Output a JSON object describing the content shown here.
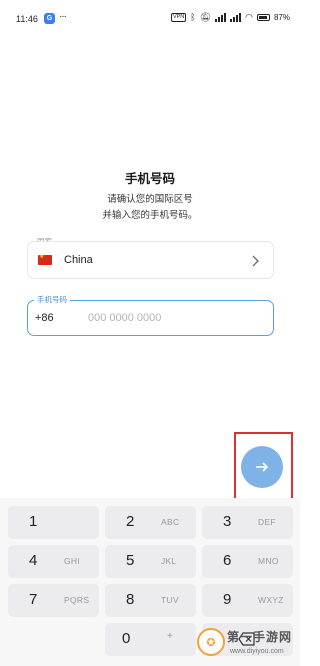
{
  "status_bar": {
    "time": "11:46",
    "app_icon_letter": "G",
    "overflow": "···",
    "vpn": "VPN",
    "battery_pct": "87%"
  },
  "heading": {
    "title": "手机号码",
    "line1": "请确认您的国际区号",
    "line2": "并输入您的手机号码。"
  },
  "country_field": {
    "label": "国家",
    "value": "China",
    "icon": "china-flag"
  },
  "phone_field": {
    "label": "手机号码",
    "country_code": "+86",
    "placeholder": "000 0000 0000",
    "value": ""
  },
  "next_button": {
    "icon": "arrow-right-icon",
    "color": "#7fb2e7",
    "highlight_color": "#d8342f"
  },
  "keypad": {
    "keys": [
      {
        "digit": "1",
        "letters": ""
      },
      {
        "digit": "2",
        "letters": "ABC"
      },
      {
        "digit": "3",
        "letters": "DEF"
      },
      {
        "digit": "4",
        "letters": "GHI"
      },
      {
        "digit": "5",
        "letters": "JKL"
      },
      {
        "digit": "6",
        "letters": "MNO"
      },
      {
        "digit": "7",
        "letters": "PQRS"
      },
      {
        "digit": "8",
        "letters": "TUV"
      },
      {
        "digit": "9",
        "letters": "WXYZ"
      },
      {
        "digit": "0",
        "letters": "+"
      }
    ],
    "backspace_icon": "backspace-icon"
  },
  "watermark": {
    "name": "第一手游网",
    "url": "www.diyiyou.com"
  },
  "colors": {
    "accent": "#5ba1d8",
    "keypad_bg": "#f7f7f8",
    "key_bg": "#ececee"
  }
}
